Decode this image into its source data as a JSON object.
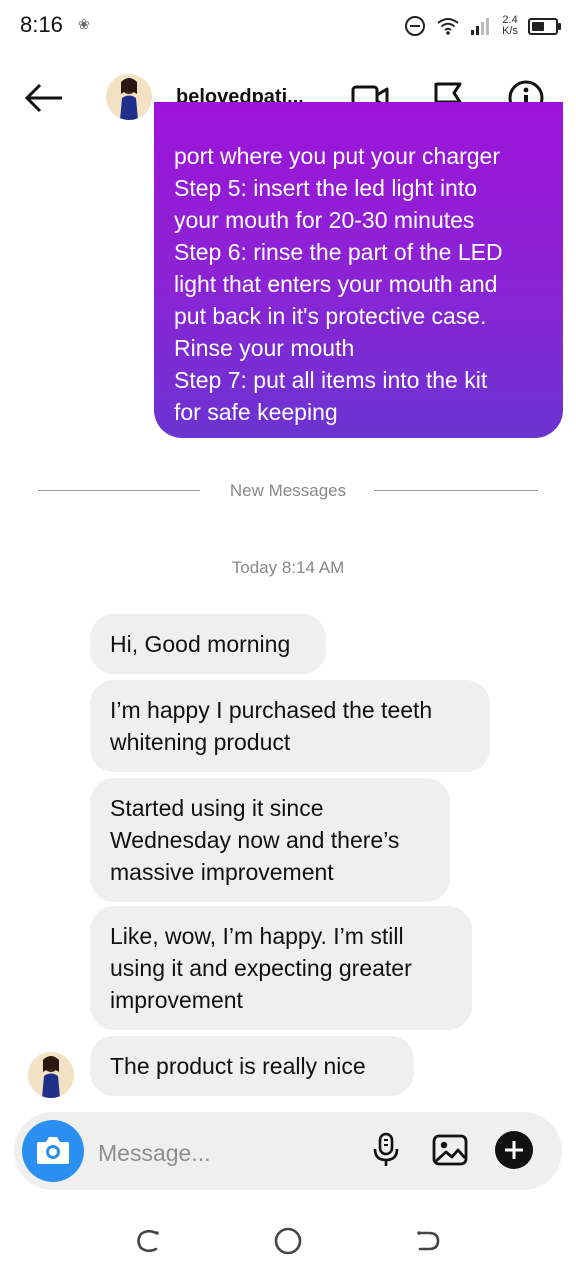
{
  "status": {
    "time": "8:16",
    "speed_top": "2.4",
    "speed_bottom": "K/s",
    "battery_level": 0.55
  },
  "header": {
    "username": "belovedpati..."
  },
  "sent_message": {
    "lines": [
      "port where you put your charger",
      "Step 5: insert the led light into",
      "your mouth for 20-30 minutes",
      "Step 6: rinse the part of the LED",
      "light that enters your mouth and",
      "put back in it's protective case.",
      "Rinse your mouth",
      "Step 7: put all items into the kit",
      "for safe keeping"
    ]
  },
  "divider": {
    "label": "New Messages"
  },
  "timestamp": "Today 8:14 AM",
  "received_messages": [
    {
      "lines": [
        "Hi, Good morning"
      ]
    },
    {
      "lines": [
        "I’m happy I purchased the teeth",
        "whitening product"
      ]
    },
    {
      "lines": [
        "Started using it since",
        "Wednesday now and there’s",
        "massive improvement"
      ]
    },
    {
      "lines": [
        "Like, wow, I’m happy. I’m still",
        "using it and expecting greater",
        "improvement"
      ]
    },
    {
      "lines": [
        "The product is really nice"
      ]
    }
  ],
  "composer": {
    "placeholder": "Message..."
  },
  "colors": {
    "accent_blue": "#2a8ff0",
    "bubble_gray": "#efefef",
    "sent_gradient_top": "#9d14d8",
    "sent_gradient_bottom": "#6b34d1"
  }
}
